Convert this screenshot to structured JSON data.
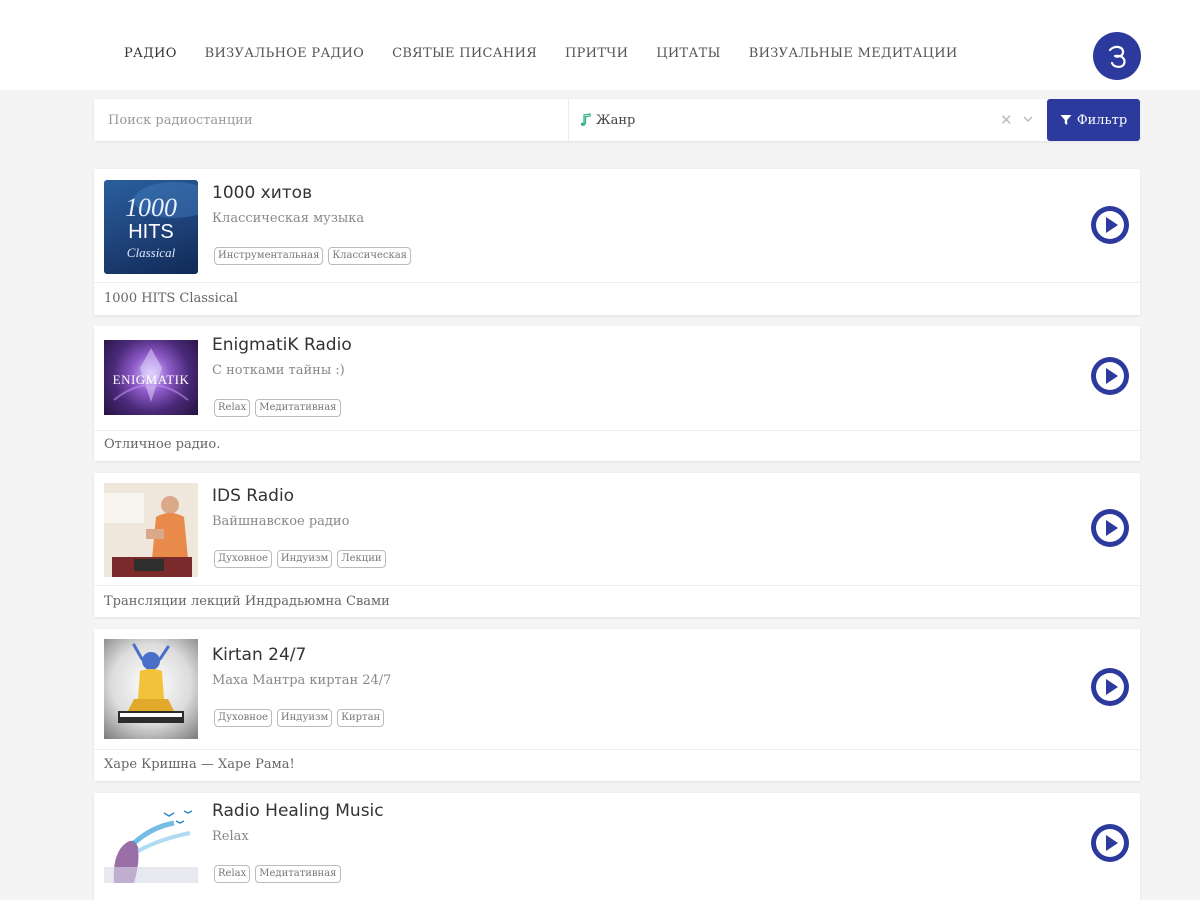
{
  "nav": {
    "items": [
      {
        "label": "РАДИО"
      },
      {
        "label": "ВИЗУАЛЬНОЕ РАДИО"
      },
      {
        "label": "СВЯТЫЕ ПИСАНИЯ"
      },
      {
        "label": "ПРИТЧИ"
      },
      {
        "label": "ЦИТАТЫ"
      },
      {
        "label": "ВИЗУАЛЬНЫЕ МЕДИТАЦИИ"
      }
    ]
  },
  "search": {
    "placeholder": "Поиск радиостанции",
    "genre_label": "Жанр",
    "clear_icon": "close-icon",
    "chevron_icon": "chevron-down-icon",
    "filter_label": "Фильтр"
  },
  "colors": {
    "accent": "#2b3a9c",
    "background": "#f4f4f5"
  },
  "stations": [
    {
      "title": "1000 хитов",
      "subtitle": "Классическая музыка",
      "tags": [
        "Инструментальная",
        "Классическая"
      ],
      "description": "1000 HITS Classical",
      "logo_text_big": "1000",
      "logo_text_mid": "HITS",
      "logo_text_small": "Classical"
    },
    {
      "title": "EnigmatiK Radio",
      "subtitle": "С нотками тайны :)",
      "tags": [
        "Relax",
        "Медитативная"
      ],
      "description": "Отличное радио.",
      "logo_text": "ENIGMATIK"
    },
    {
      "title": "IDS Radio",
      "subtitle": "Вайшнавское радио",
      "tags": [
        "Духовное",
        "Индуизм",
        "Лекции"
      ],
      "description": "Трансляции лекций Индрадьюмна Свами"
    },
    {
      "title": "Kirtan 24/7",
      "subtitle": "Маха Мантра киртан 24/7",
      "tags": [
        "Духовное",
        "Индуизм",
        "Киртан"
      ],
      "description": "Харе Кришна — Харе Рама!"
    },
    {
      "title": "Radio Healing Music",
      "subtitle": "Relax",
      "tags": [
        "Relax",
        "Медитативная"
      ],
      "description": ""
    }
  ]
}
